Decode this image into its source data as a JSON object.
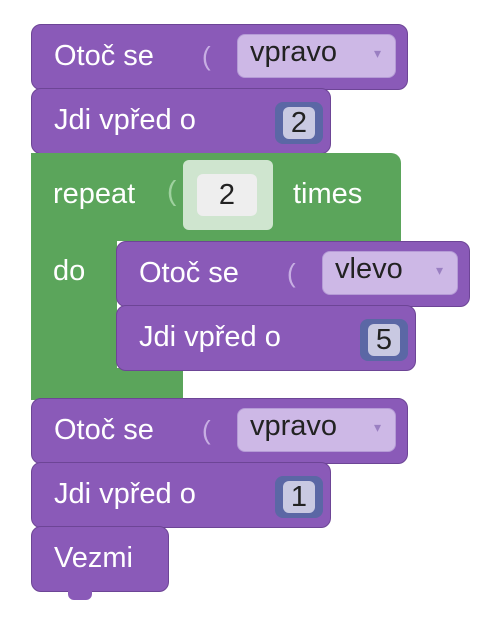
{
  "blocks": {
    "turn1": {
      "label": "Otoč se",
      "direction": "vpravo"
    },
    "move1": {
      "label": "Jdi vpřed o",
      "value": "2"
    },
    "repeat": {
      "label": "repeat",
      "count": "2",
      "times_label": "times",
      "do_label": "do"
    },
    "turn_inner": {
      "label": "Otoč se",
      "direction": "vlevo"
    },
    "move_inner": {
      "label": "Jdi vpřed o",
      "value": "5"
    },
    "turn2": {
      "label": "Otoč se",
      "direction": "vpravo"
    },
    "move2": {
      "label": "Jdi vpřed o",
      "value": "1"
    },
    "take": {
      "label": "Vezmi"
    }
  },
  "dropdown_arrow": "▾",
  "colors": {
    "motion": "#8a5ab8",
    "loop": "#5ba55b",
    "number": "#5b67a5",
    "dropdown": "#cdb8e6"
  }
}
